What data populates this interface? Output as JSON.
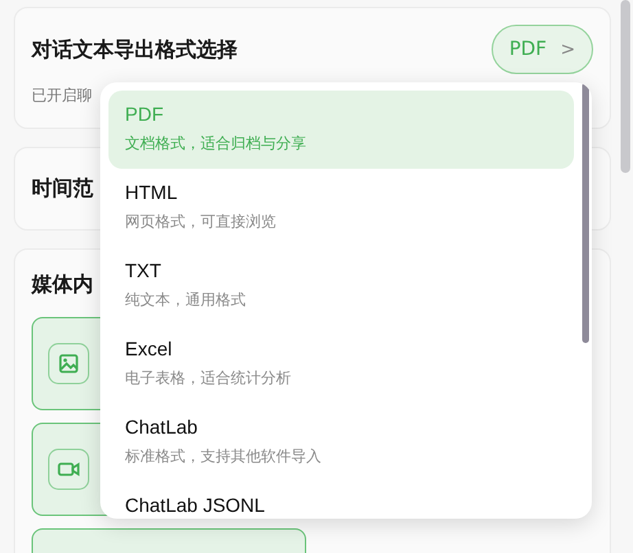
{
  "export_card": {
    "title": "对话文本导出格式选择",
    "subtitle": "已开启聊",
    "format_button": {
      "label": "PDF",
      "chevron": ">"
    }
  },
  "time_card": {
    "title": "时间范"
  },
  "media_card": {
    "title": "媒体内",
    "tiles": [
      {
        "kind": "image",
        "selected": true
      },
      {
        "kind": "video",
        "selected": true
      },
      {
        "kind": "blank",
        "selected": true
      }
    ]
  },
  "format_menu": {
    "options": [
      {
        "label": "PDF",
        "description": "文档格式，适合归档与分享",
        "selected": true
      },
      {
        "label": "HTML",
        "description": "网页格式，可直接浏览",
        "selected": false
      },
      {
        "label": "TXT",
        "description": "纯文本，通用格式",
        "selected": false
      },
      {
        "label": "Excel",
        "description": "电子表格，适合统计分析",
        "selected": false
      },
      {
        "label": "ChatLab",
        "description": "标准格式，支持其他软件导入",
        "selected": false
      },
      {
        "label": "ChatLab JSONL",
        "selected": false
      }
    ]
  }
}
